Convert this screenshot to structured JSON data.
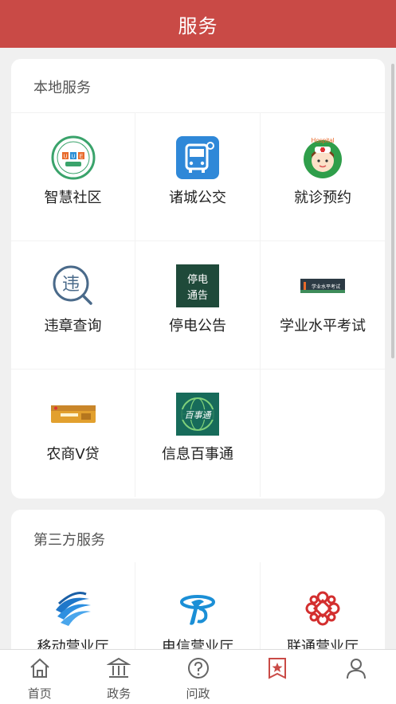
{
  "header": {
    "title": "服务"
  },
  "local": {
    "title": "本地服务",
    "items": [
      {
        "label": "智慧社区",
        "icon": "smart-community-icon",
        "badge": "UUE"
      },
      {
        "label": "诸城公交",
        "icon": "bus-icon"
      },
      {
        "label": "就诊预约",
        "icon": "nurse-icon",
        "badge": "Hospital"
      },
      {
        "label": "违章查询",
        "icon": "violation-search-icon",
        "glyph": "违"
      },
      {
        "label": "停电公告",
        "icon": "power-outage-icon",
        "line1": "停电",
        "line2": "通告"
      },
      {
        "label": "学业水平考试",
        "icon": "exam-icon",
        "banner": "学业水平考试"
      },
      {
        "label": "农商V贷",
        "icon": "loan-card-icon"
      },
      {
        "label": "信息百事通",
        "icon": "info-icon",
        "badge": "百事通"
      }
    ]
  },
  "third": {
    "title": "第三方服务",
    "items": [
      {
        "label": "移动营业厅",
        "icon": "china-mobile-icon"
      },
      {
        "label": "电信营业厅",
        "icon": "china-telecom-icon"
      },
      {
        "label": "联通营业厅",
        "icon": "china-unicom-icon"
      }
    ]
  },
  "tabbar": [
    {
      "label": "首页",
      "icon": "home-icon"
    },
    {
      "label": "政务",
      "icon": "government-icon"
    },
    {
      "label": "问政",
      "icon": "question-icon"
    },
    {
      "label": "",
      "icon": "service-star-icon",
      "active": true
    },
    {
      "label": "",
      "icon": "profile-icon"
    }
  ],
  "colors": {
    "brand": "#c94a46",
    "page_bg": "#f0f0f0"
  }
}
